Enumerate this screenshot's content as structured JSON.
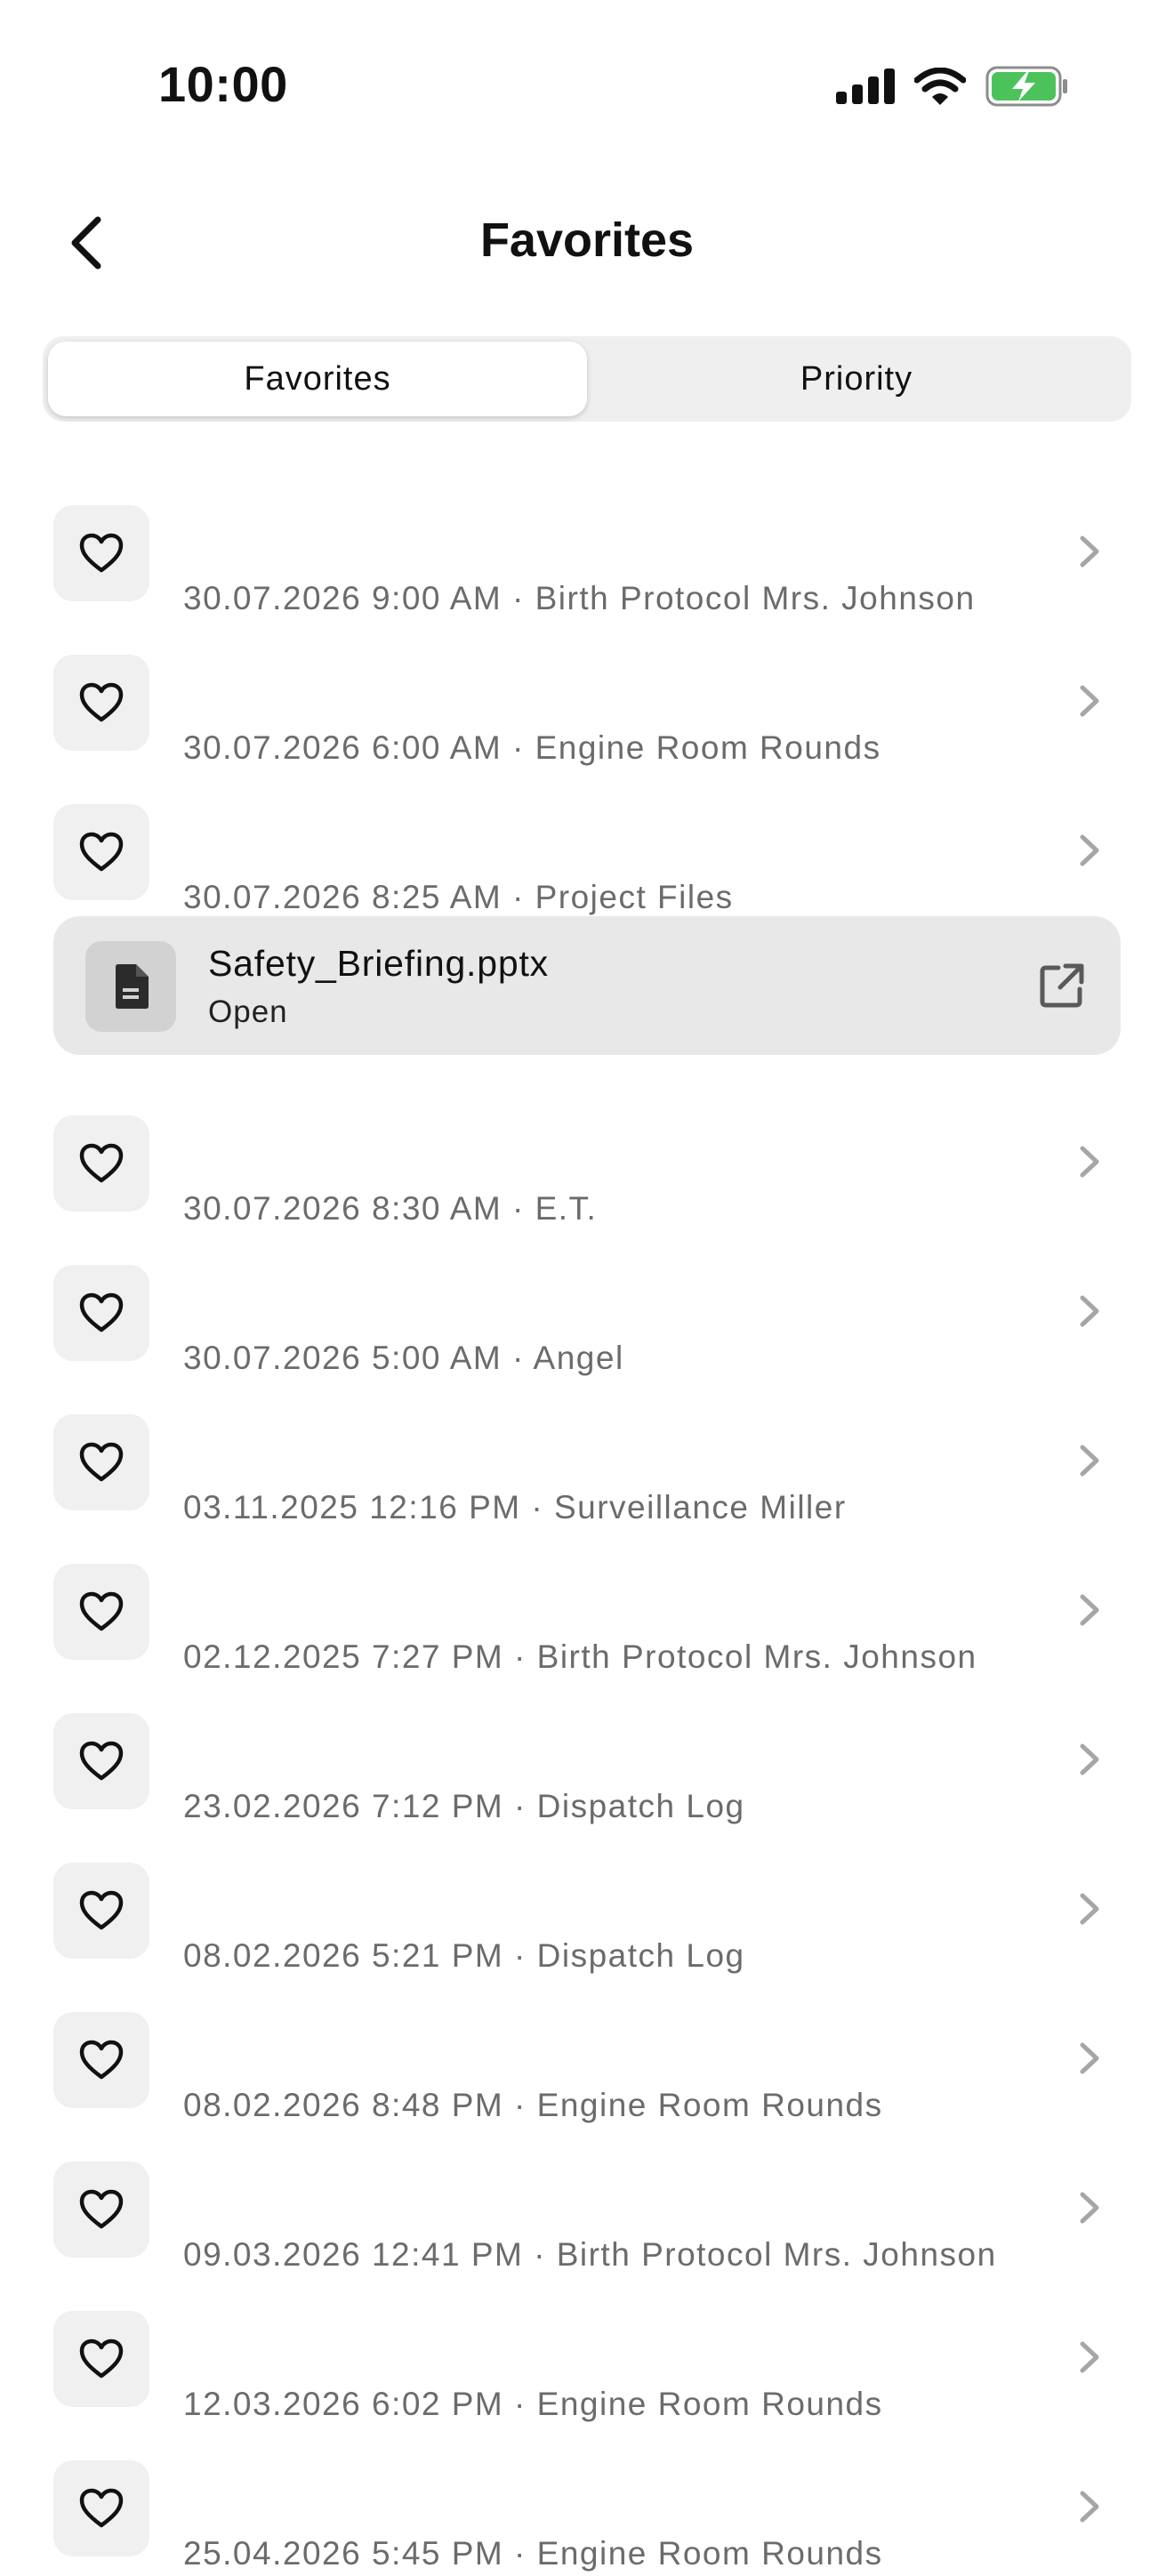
{
  "status_bar": {
    "time": "10:00"
  },
  "nav": {
    "title": "Favorites"
  },
  "tabs": [
    {
      "label": "Favorites",
      "active": true
    },
    {
      "label": "Priority",
      "active": false
    }
  ],
  "items": [
    {
      "text": "30.07.2026 9:00 AM · Birth Protocol Mrs. Johnson"
    },
    {
      "text": "30.07.2026 6:00 AM · Engine Room Rounds"
    },
    {
      "text": "30.07.2026 8:25 AM · Project Files",
      "attachment": {
        "file_name": "Safety_Briefing.pptx",
        "action": "Open"
      }
    },
    {
      "text": "30.07.2026 8:30 AM · E.T."
    },
    {
      "text": "30.07.2026 5:00 AM · Angel"
    },
    {
      "text": "03.11.2025 12:16 PM · Surveillance Miller"
    },
    {
      "text": "02.12.2025 7:27 PM · Birth Protocol Mrs. Johnson"
    },
    {
      "text": "23.02.2026 7:12 PM · Dispatch Log"
    },
    {
      "text": "08.02.2026 5:21 PM · Dispatch Log"
    },
    {
      "text": "08.02.2026 8:48 PM · Engine Room Rounds"
    },
    {
      "text": "09.03.2026 12:41 PM · Birth Protocol Mrs. Johnson"
    },
    {
      "text": "12.03.2026 6:02 PM · Engine Room Rounds"
    },
    {
      "text": "25.04.2026 5:45 PM · Engine Room Rounds"
    }
  ],
  "colors": {
    "battery_fill": "#4cc35a",
    "muted_text": "#6b6b6b",
    "tile_bg": "#f0f0f0",
    "card_bg": "#e8e8e8"
  }
}
